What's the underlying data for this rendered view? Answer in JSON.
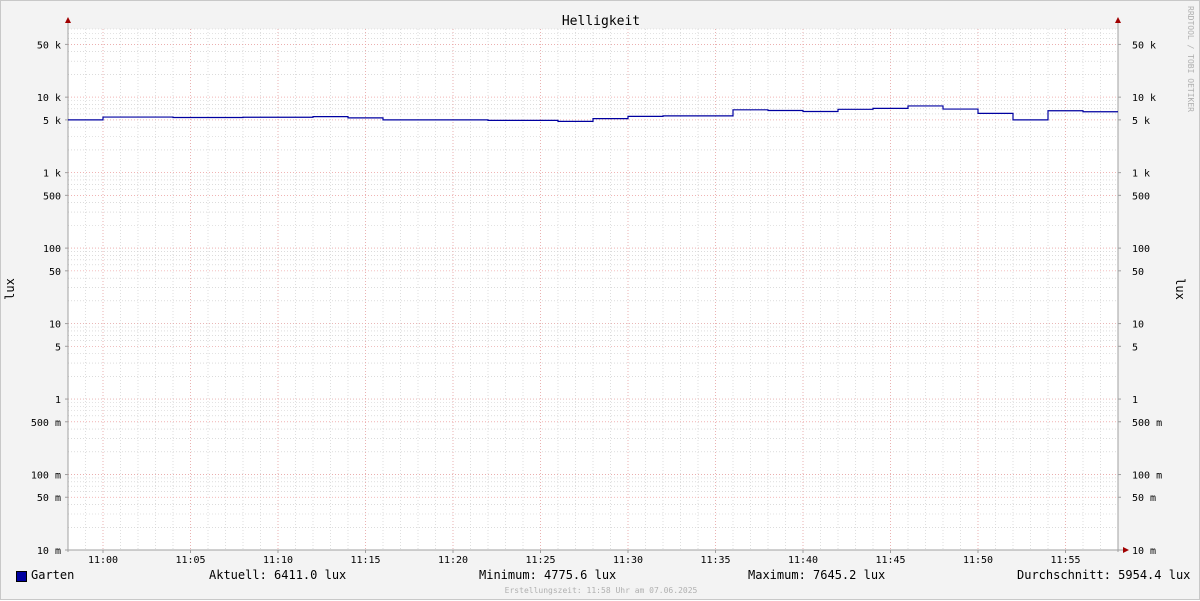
{
  "chart_data": {
    "type": "line",
    "title": "Helligkeit",
    "ylabel": "lux",
    "ylabel_right": "lux",
    "yscale": "log",
    "ylim": [
      0.01,
      80000
    ],
    "y_ticks": [
      {
        "v": 50000,
        "label": "50 k"
      },
      {
        "v": 10000,
        "label": "10 k"
      },
      {
        "v": 5000,
        "label": "5 k"
      },
      {
        "v": 1000,
        "label": "1 k"
      },
      {
        "v": 500,
        "label": "500"
      },
      {
        "v": 100,
        "label": "100"
      },
      {
        "v": 50,
        "label": "50"
      },
      {
        "v": 10,
        "label": "10"
      },
      {
        "v": 5,
        "label": "5"
      },
      {
        "v": 1,
        "label": "1"
      },
      {
        "v": 0.5,
        "label": "500 m"
      },
      {
        "v": 0.1,
        "label": "100 m"
      },
      {
        "v": 0.05,
        "label": "50 m"
      },
      {
        "v": 0.01,
        "label": "10 m"
      }
    ],
    "xlim": [
      "10:58",
      "11:58"
    ],
    "x_ticks": [
      "11:00",
      "11:05",
      "11:10",
      "11:15",
      "11:20",
      "11:25",
      "11:30",
      "11:35",
      "11:40",
      "11:45",
      "11:50",
      "11:55"
    ],
    "grid": true,
    "legend_position": "bottom",
    "series": [
      {
        "name": "Garten",
        "color": "#0000a0",
        "x": [
          "10:58",
          "11:00",
          "11:02",
          "11:04",
          "11:06",
          "11:08",
          "11:10",
          "11:12",
          "11:14",
          "11:16",
          "11:18",
          "11:20",
          "11:22",
          "11:24",
          "11:26",
          "11:28",
          "11:30",
          "11:32",
          "11:34",
          "11:36",
          "11:38",
          "11:40",
          "11:42",
          "11:44",
          "11:46",
          "11:48",
          "11:50",
          "11:52",
          "11:54",
          "11:56",
          "11:58"
        ],
        "values": [
          5000,
          5450,
          5450,
          5380,
          5380,
          5420,
          5420,
          5520,
          5320,
          5000,
          5000,
          5000,
          4920,
          4920,
          4775.6,
          5200,
          5570,
          5650,
          5650,
          6800,
          6650,
          6450,
          6900,
          7100,
          7645.2,
          6950,
          6100,
          5000,
          6600,
          6411,
          6411
        ]
      }
    ]
  },
  "legend": {
    "series_name": "Garten",
    "aktuell": "Aktuell: 6411.0 lux",
    "minimum": "Minimum: 4775.6 lux",
    "maximum": "Maximum: 7645.2 lux",
    "durchschnitt": "Durchschnitt: 5954.4 lux"
  },
  "footer": "Erstellungszeit: 11:58 Uhr am 07.06.2025",
  "watermark": "RRDTOOL / TOBI OETIKER",
  "colors": {
    "grid_minor": "#c8c8c8",
    "grid_major": "#f0a0a0",
    "axis": "#a0a0a0",
    "arrow": "#a00000"
  }
}
